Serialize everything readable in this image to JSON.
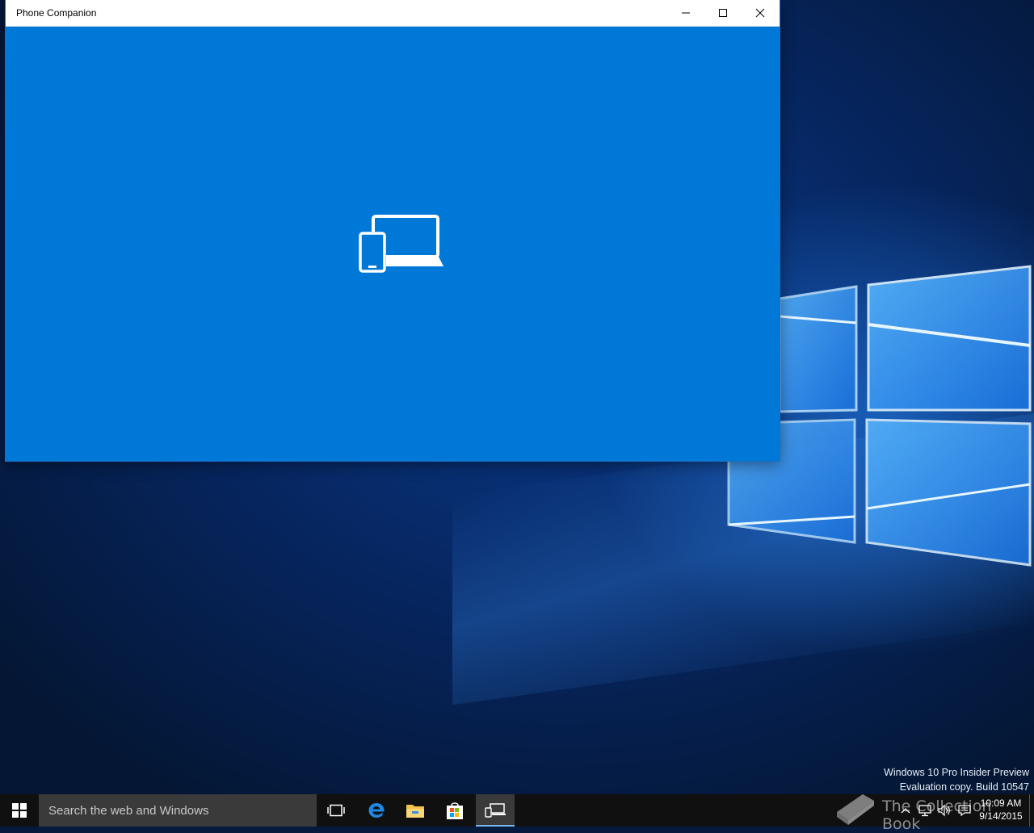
{
  "window": {
    "title": "Phone Companion",
    "minimize_icon": "minimize-icon",
    "maximize_icon": "maximize-icon",
    "close_icon": "close-icon",
    "accent_color": "#0078d7",
    "app_icon": "phone-laptop-icon"
  },
  "watermark": {
    "line1": "Windows 10 Pro Insider Preview",
    "line2": "Evaluation copy. Build 10547"
  },
  "taskbar": {
    "search_placeholder": "Search the web and Windows",
    "apps": [
      {
        "name": "task-view",
        "icon": "task-view-icon"
      },
      {
        "name": "edge",
        "icon": "edge-icon"
      },
      {
        "name": "file-explorer",
        "icon": "folder-icon"
      },
      {
        "name": "store",
        "icon": "store-icon"
      },
      {
        "name": "phone-companion",
        "icon": "phone-laptop-icon",
        "active": true
      }
    ],
    "clock": {
      "time": "10:09 AM",
      "date": "9/14/2015"
    },
    "overlay_text": "The Collection Book"
  }
}
